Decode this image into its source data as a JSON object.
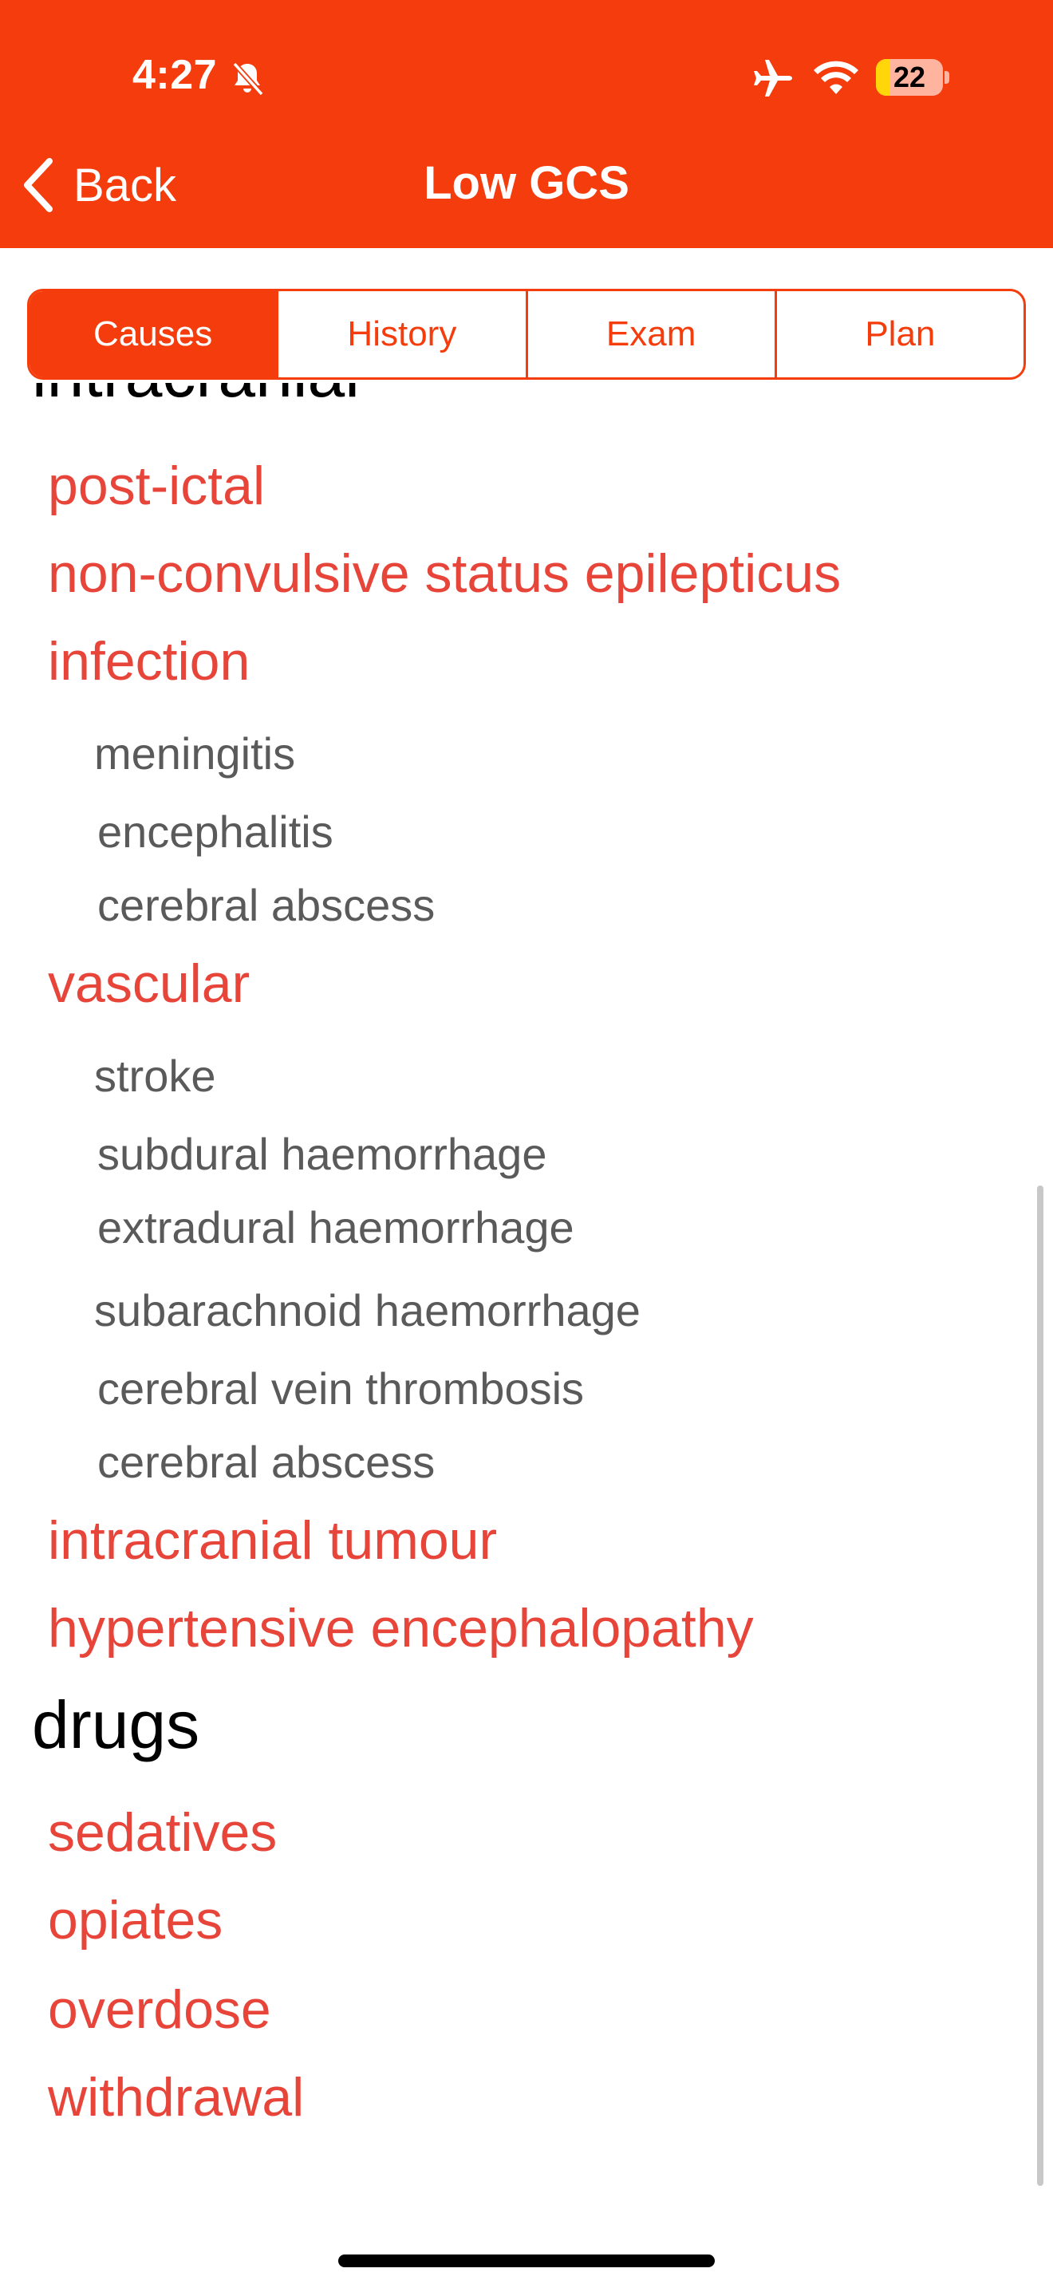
{
  "status_bar": {
    "time": "4:27",
    "battery": "22",
    "battery_level": 0.22
  },
  "nav": {
    "back_label": "Back",
    "title": "Low GCS"
  },
  "tabs": [
    {
      "label": "Causes",
      "active": true
    },
    {
      "label": "History",
      "active": false
    },
    {
      "label": "Exam",
      "active": false
    },
    {
      "label": "Plan",
      "active": false
    }
  ],
  "causes": {
    "clipped_heading": "intracranial",
    "items": [
      "post-ictal",
      "non-convulsive status epilepticus",
      "infection",
      "meningitis",
      "encephalitis",
      "cerebral abscess",
      "vascular",
      "stroke",
      "subdural haemorrhage",
      "extradural haemorrhage",
      "subarachnoid haemorrhage",
      "cerebral vein thrombosis",
      "cerebral abscess",
      "intracranial tumour",
      "hypertensive encephalopathy"
    ],
    "drugs_heading": "drugs",
    "drugs": [
      "sedatives",
      "opiates",
      "overdose",
      "withdrawal"
    ]
  },
  "colors": {
    "accent": "#f53c0c",
    "category_text": "#e8453a",
    "sub_text": "#5a5a5a"
  }
}
